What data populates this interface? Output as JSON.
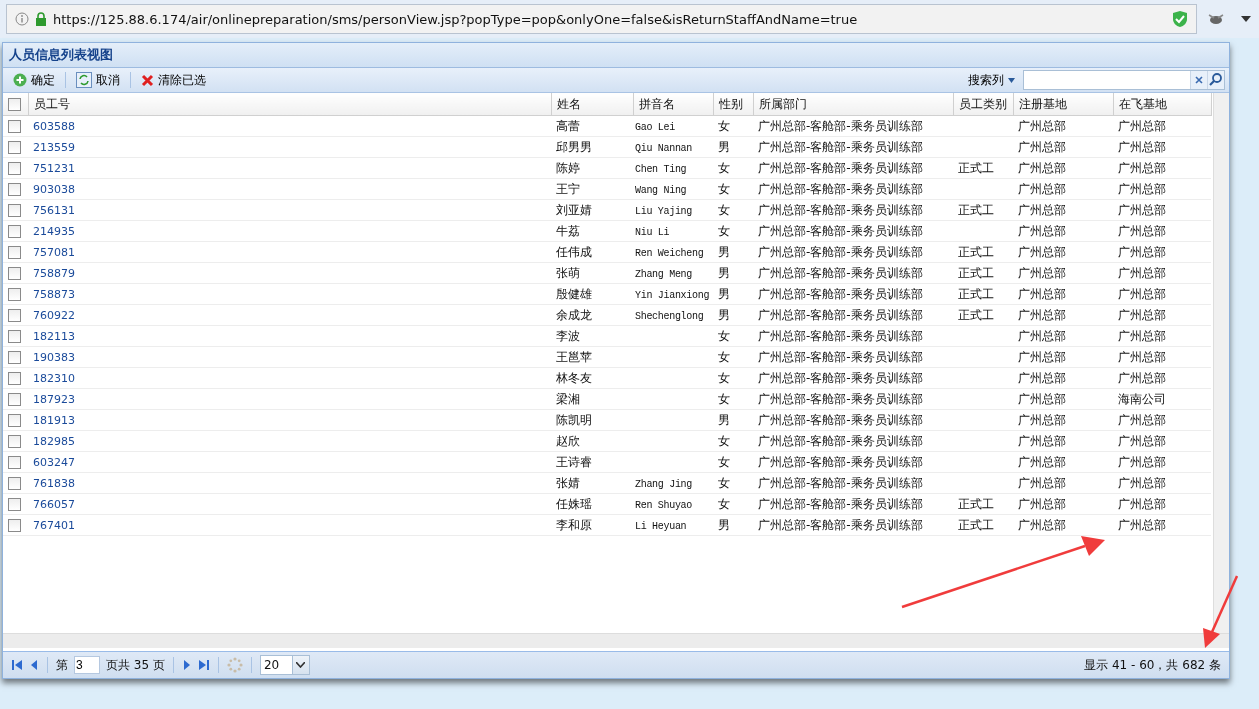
{
  "browser": {
    "url": "https://125.88.6.174/air/onlinepreparation/sms/personView.jsp?popType=pop&onlyOne=false&isReturnStaffAndName=true"
  },
  "panel": {
    "title": "人员信息列表视图"
  },
  "toolbar": {
    "buttons": [
      {
        "kind": "add",
        "label": "确定"
      },
      {
        "kind": "refresh",
        "label": "取消"
      },
      {
        "kind": "delete",
        "label": "清除已选"
      }
    ],
    "search_label": "搜索列"
  },
  "table": {
    "select_all": {
      "checked": false
    },
    "columns": [
      "员工号",
      "姓名",
      "拼音名",
      "性别",
      "所属部门",
      "员工类别",
      "注册基地",
      "在飞基地"
    ],
    "rows": [
      {
        "checked": false,
        "id": "603588",
        "name": "高蕾",
        "pinyin": "Gao Lei",
        "sex": "女",
        "dept": "广州总部-客舱部-乘务员训练部",
        "reg": "广州总部",
        "fly": "广州总部"
      },
      {
        "checked": false,
        "id": "213559",
        "name": "邱男男",
        "pinyin": "Qiu Nannan",
        "sex": "男",
        "dept": "广州总部-客舱部-乘务员训练部",
        "reg": "广州总部",
        "fly": "广州总部"
      },
      {
        "checked": false,
        "id": "751231",
        "name": "陈婷",
        "pinyin": "Chen Ting",
        "sex": "女",
        "dept": "广州总部-客舱部-乘务员训练部",
        "type": "正式工",
        "reg": "广州总部",
        "fly": "广州总部"
      },
      {
        "checked": false,
        "id": "903038",
        "name": "王宁",
        "pinyin": "Wang Ning",
        "sex": "女",
        "dept": "广州总部-客舱部-乘务员训练部",
        "reg": "广州总部",
        "fly": "广州总部"
      },
      {
        "checked": false,
        "id": "756131",
        "name": "刘亚婧",
        "pinyin": "Liu Yajing",
        "sex": "女",
        "dept": "广州总部-客舱部-乘务员训练部",
        "type": "正式工",
        "reg": "广州总部",
        "fly": "广州总部"
      },
      {
        "checked": false,
        "id": "214935",
        "name": "牛荔",
        "pinyin": "Niu Li",
        "sex": "女",
        "dept": "广州总部-客舱部-乘务员训练部",
        "reg": "广州总部",
        "fly": "广州总部"
      },
      {
        "checked": false,
        "id": "757081",
        "name": "任伟成",
        "pinyin": "Ren Weicheng",
        "sex": "男",
        "dept": "广州总部-客舱部-乘务员训练部",
        "type": "正式工",
        "reg": "广州总部",
        "fly": "广州总部"
      },
      {
        "checked": false,
        "id": "758879",
        "name": "张萌",
        "pinyin": "Zhang Meng",
        "sex": "男",
        "dept": "广州总部-客舱部-乘务员训练部",
        "type": "正式工",
        "reg": "广州总部",
        "fly": "广州总部"
      },
      {
        "checked": false,
        "id": "758873",
        "name": "殷健雄",
        "pinyin": "Yin Jianxiong",
        "sex": "男",
        "dept": "广州总部-客舱部-乘务员训练部",
        "type": "正式工",
        "reg": "广州总部",
        "fly": "广州总部"
      },
      {
        "checked": false,
        "id": "760922",
        "name": "余成龙",
        "pinyin": "Shechenglong",
        "sex": "男",
        "dept": "广州总部-客舱部-乘务员训练部",
        "type": "正式工",
        "reg": "广州总部",
        "fly": "广州总部"
      },
      {
        "checked": false,
        "id": "182113",
        "name": "李波",
        "sex": "女",
        "dept": "广州总部-客舱部-乘务员训练部",
        "reg": "广州总部",
        "fly": "广州总部"
      },
      {
        "checked": false,
        "id": "190383",
        "name": "王邕苹",
        "sex": "女",
        "dept": "广州总部-客舱部-乘务员训练部",
        "reg": "广州总部",
        "fly": "广州总部"
      },
      {
        "checked": false,
        "id": "182310",
        "name": "林冬友",
        "sex": "女",
        "dept": "广州总部-客舱部-乘务员训练部",
        "reg": "广州总部",
        "fly": "广州总部"
      },
      {
        "checked": false,
        "id": "187923",
        "name": "梁湘",
        "sex": "女",
        "dept": "广州总部-客舱部-乘务员训练部",
        "reg": "广州总部",
        "fly": "海南公司"
      },
      {
        "checked": false,
        "id": "181913",
        "name": "陈凯明",
        "sex": "男",
        "dept": "广州总部-客舱部-乘务员训练部",
        "reg": "广州总部",
        "fly": "广州总部"
      },
      {
        "checked": false,
        "id": "182985",
        "name": "赵欣",
        "sex": "女",
        "dept": "广州总部-客舱部-乘务员训练部",
        "reg": "广州总部",
        "fly": "广州总部"
      },
      {
        "checked": false,
        "id": "603247",
        "name": "王诗睿",
        "sex": "女",
        "dept": "广州总部-客舱部-乘务员训练部",
        "reg": "广州总部",
        "fly": "广州总部"
      },
      {
        "checked": false,
        "id": "761838",
        "name": "张婧",
        "pinyin": "Zhang Jing",
        "sex": "女",
        "dept": "广州总部-客舱部-乘务员训练部",
        "reg": "广州总部",
        "fly": "广州总部"
      },
      {
        "checked": false,
        "id": "766057",
        "name": "任姝瑶",
        "pinyin": "Ren Shuyao",
        "sex": "女",
        "dept": "广州总部-客舱部-乘务员训练部",
        "type": "正式工",
        "reg": "广州总部",
        "fly": "广州总部"
      },
      {
        "checked": false,
        "id": "767401",
        "name": "李和原",
        "pinyin": "Li Heyuan",
        "sex": "男",
        "dept": "广州总部-客舱部-乘务员训练部",
        "type": "正式工",
        "reg": "广州总部",
        "fly": "广州总部"
      }
    ]
  },
  "pager": {
    "page_prefix": "第",
    "page": "3",
    "page_suffix": "页共 35 页",
    "page_size": "20",
    "summary": "显示 41 - 60，共 682 条"
  }
}
